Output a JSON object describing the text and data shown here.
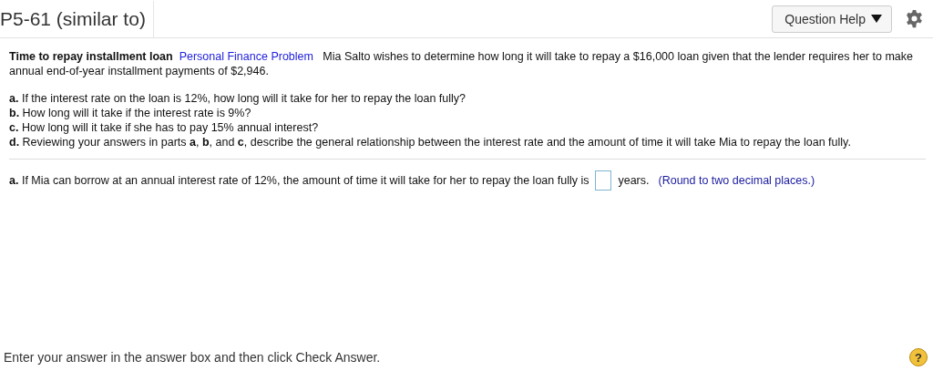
{
  "header": {
    "title": "P5-61 (similar to)",
    "help_button": "Question Help"
  },
  "problem": {
    "heading": "Time to repay installment loan",
    "category": "Personal Finance Problem",
    "text": "Mia Salto wishes to determine how long it will take to repay a $16,000 loan given that the lender requires her to make annual end-of-year installment payments of $2,946."
  },
  "parts": [
    {
      "text": "**a.** If the interest rate on the loan is 12%, how long will it take for her to repay the loan fully?"
    },
    {
      "text": "**b.** How long will it take if the interest rate is 9%?"
    },
    {
      "text": "**c.** How long will it take if she has to pay 15% annual interest?"
    },
    {
      "text": "**d.** Reviewing your answers in parts **a**, **b**, and **c**, describe the general relationship between the interest rate and the amount of time it will take Mia to repay the loan fully."
    }
  ],
  "answer": {
    "prompt": "**a.** If Mia can borrow at an annual interest rate of 12%, the amount of time it will take for her to repay the loan fully is",
    "unit": "years.",
    "hint": "(Round to two decimal places.)"
  },
  "footer": {
    "instruction": "Enter your answer in the answer box and then click Check Answer.",
    "help_icon": "?"
  }
}
